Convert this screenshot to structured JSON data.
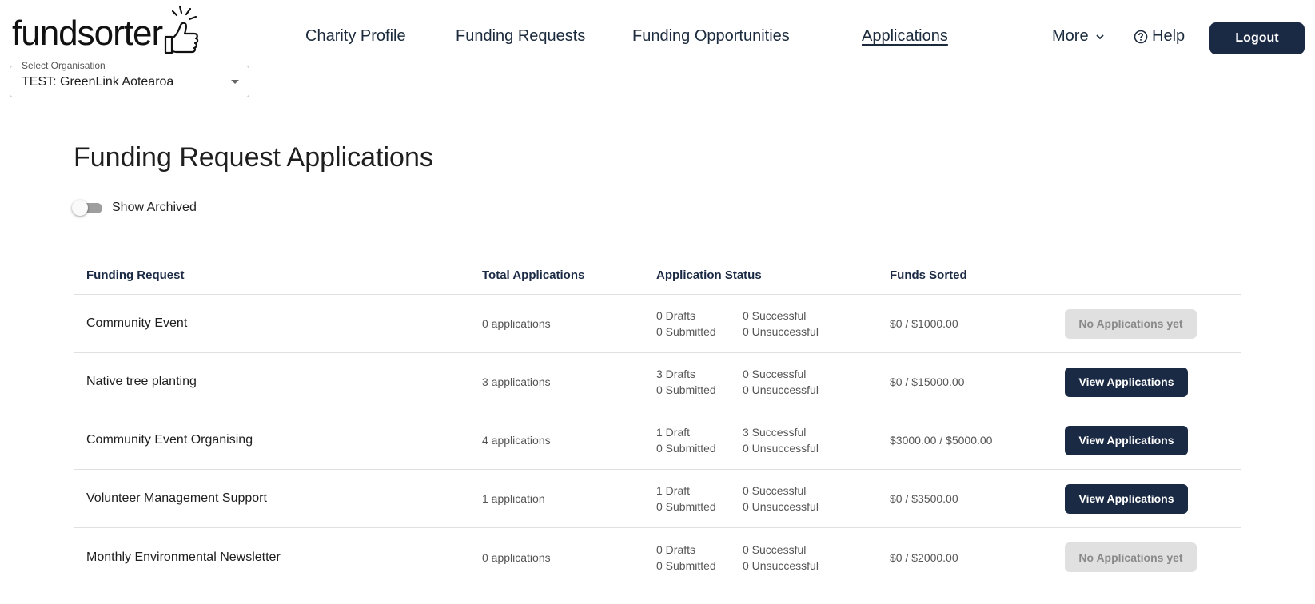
{
  "header": {
    "logo_text": "fundsorter",
    "nav": {
      "charity_profile": "Charity Profile",
      "funding_requests": "Funding Requests",
      "funding_opportunities": "Funding Opportunities",
      "applications": "Applications",
      "more": "More",
      "help": "Help",
      "logout": "Logout"
    },
    "active_nav": "applications"
  },
  "org_select": {
    "legend": "Select Organisation",
    "value": "TEST: GreenLink Aotearoa"
  },
  "page": {
    "title": "Funding Request Applications",
    "show_archived_label": "Show Archived",
    "show_archived_on": false
  },
  "table": {
    "headers": [
      "Funding Request",
      "Total Applications",
      "Application Status",
      "Funds Sorted"
    ],
    "rows": [
      {
        "name": "Community Event",
        "total": "0 applications",
        "drafts": "0 Drafts",
        "submitted": "0 Submitted",
        "successful": "0 Successful",
        "unsuccessful": "0 Unsuccessful",
        "funds": "$0 / $1000.00",
        "action": "No Applications yet"
      },
      {
        "name": "Native tree planting",
        "total": "3 applications",
        "drafts": "3 Drafts",
        "submitted": "0 Submitted",
        "successful": "0 Successful",
        "unsuccessful": "0 Unsuccessful",
        "funds": "$0 / $15000.00",
        "action": "View Applications"
      },
      {
        "name": "Community Event Organising",
        "total": "4 applications",
        "drafts": "1 Draft",
        "submitted": "0 Submitted",
        "successful": "3 Successful",
        "unsuccessful": "0 Unsuccessful",
        "funds": "$3000.00 / $5000.00",
        "action": "View Applications"
      },
      {
        "name": "Volunteer Management Support",
        "total": "1 application",
        "drafts": "1 Draft",
        "submitted": "0 Submitted",
        "successful": "0 Successful",
        "unsuccessful": "0 Unsuccessful",
        "funds": "$0 / $3500.00",
        "action": "View Applications"
      },
      {
        "name": "Monthly Environmental Newsletter",
        "total": "0 applications",
        "drafts": "0 Drafts",
        "submitted": "0 Submitted",
        "successful": "0 Successful",
        "unsuccessful": "0 Unsuccessful",
        "funds": "$0 / $2000.00",
        "action": "No Applications yet"
      }
    ]
  },
  "colors": {
    "primary": "#1b2a44",
    "disabled_bg": "#e0e0e0",
    "disabled_text": "#8a8a8a",
    "divider": "#e0e0e0"
  },
  "icons": {
    "logo": "thumbs-up-icon",
    "more": "chevron-down-icon",
    "help": "help-circle-icon",
    "select": "caret-down-icon"
  }
}
